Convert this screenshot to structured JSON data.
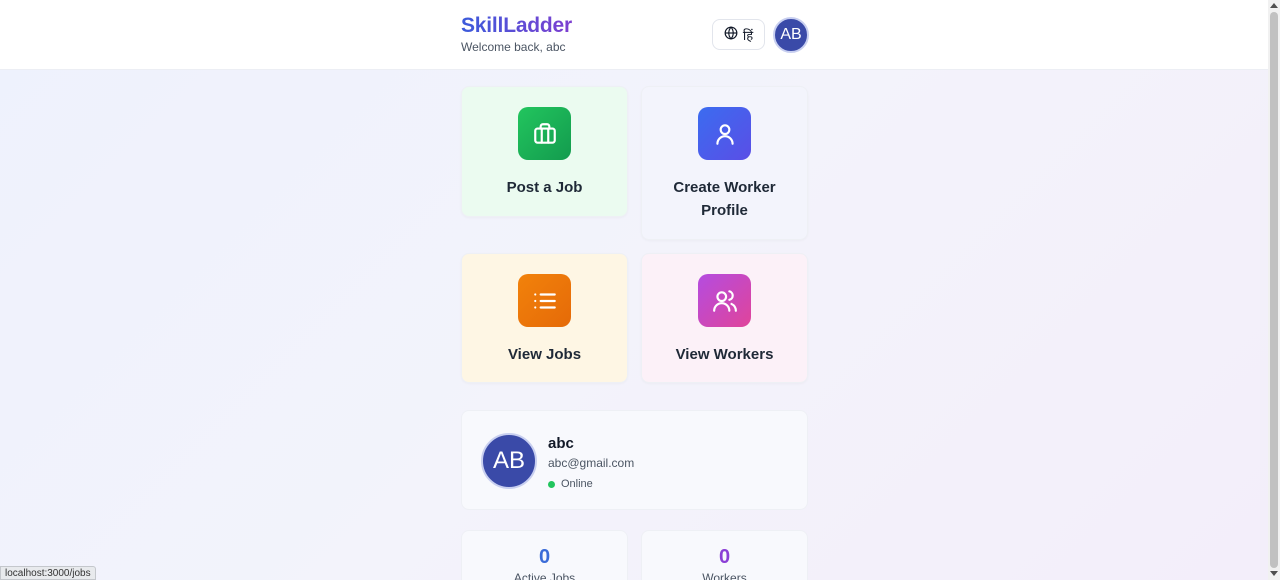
{
  "header": {
    "brand": "SkillLadder",
    "welcome": "Welcome back, abc",
    "language_label": "हिं",
    "avatar_initials": "AB"
  },
  "actions": [
    {
      "label": "Post a Job",
      "icon": "briefcase-icon",
      "color": "#16a34a"
    },
    {
      "label": "Create Worker Profile",
      "icon": "user-icon",
      "color": "#4f5bea"
    },
    {
      "label": "View Jobs",
      "icon": "list-icon",
      "color": "#ea780a"
    },
    {
      "label": "View Workers",
      "icon": "users-icon",
      "color": "#c84ab8"
    }
  ],
  "profile": {
    "initials": "AB",
    "name": "abc",
    "email": "abc@gmail.com",
    "status": "Online"
  },
  "stats": [
    {
      "value": "0",
      "label": "Active Jobs"
    },
    {
      "value": "0",
      "label": "Workers"
    }
  ],
  "status_bar": {
    "url": "localhost:3000/jobs"
  }
}
